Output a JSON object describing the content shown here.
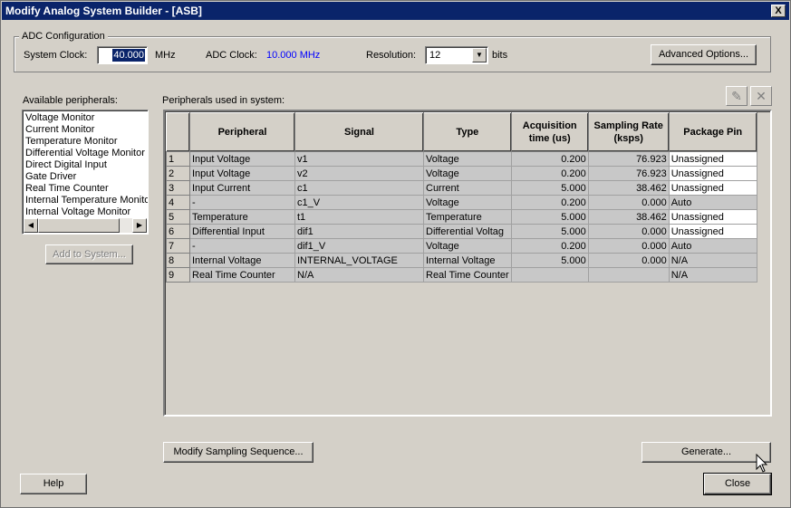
{
  "window": {
    "title": "Modify Analog System Builder - [ASB]",
    "close_glyph": "X"
  },
  "adc": {
    "group_label": "ADC Configuration",
    "system_clock_label": "System Clock:",
    "system_clock_value": "40.000",
    "system_clock_unit": "MHz",
    "adc_clock_label": "ADC Clock:",
    "adc_clock_value": "10.000 MHz",
    "adc_clock_color": "#0000ff",
    "resolution_label": "Resolution:",
    "resolution_value": "12",
    "resolution_unit": "bits",
    "advanced_button": "Advanced Options..."
  },
  "available": {
    "label": "Available peripherals:",
    "items": [
      "Voltage Monitor",
      "Current Monitor",
      "Temperature Monitor",
      "Differential Voltage Monitor",
      "Direct Digital Input",
      "Gate Driver",
      "Real Time Counter",
      "Internal Temperature Monitor",
      "Internal Voltage Monitor"
    ],
    "add_button": "Add to System..."
  },
  "used": {
    "label": "Peripherals used in system:",
    "edit_icon": "pencil-icon",
    "delete_icon": "delete-x-icon",
    "columns": [
      "",
      "Peripheral",
      "Signal",
      "Type",
      "Acquisition time (us)",
      "Sampling Rate (ksps)",
      "Package Pin"
    ],
    "rows": [
      {
        "n": "1",
        "peripheral": "Input Voltage",
        "signal": "v1",
        "type": "Voltage",
        "acq": "0.200",
        "rate": "76.923",
        "pin": "Unassigned",
        "pin_editable": true
      },
      {
        "n": "2",
        "peripheral": "Input Voltage",
        "signal": "v2",
        "type": "Voltage",
        "acq": "0.200",
        "rate": "76.923",
        "pin": "Unassigned",
        "pin_editable": true
      },
      {
        "n": "3",
        "peripheral": "Input Current",
        "signal": "c1",
        "type": "Current",
        "acq": "5.000",
        "rate": "38.462",
        "pin": "Unassigned",
        "pin_editable": true
      },
      {
        "n": "4",
        "peripheral": "-",
        "signal": "c1_V",
        "type": "Voltage",
        "acq": "0.200",
        "rate": "0.000",
        "pin": "Auto",
        "pin_editable": false
      },
      {
        "n": "5",
        "peripheral": "Temperature",
        "signal": "t1",
        "type": "Temperature",
        "acq": "5.000",
        "rate": "38.462",
        "pin": "Unassigned",
        "pin_editable": true
      },
      {
        "n": "6",
        "peripheral": "Differential Input",
        "signal": "dif1",
        "type": "Differential Voltag",
        "acq": "5.000",
        "rate": "0.000",
        "pin": "Unassigned",
        "pin_editable": true
      },
      {
        "n": "7",
        "peripheral": "-",
        "signal": "dif1_V",
        "type": "Voltage",
        "acq": "0.200",
        "rate": "0.000",
        "pin": "Auto",
        "pin_editable": false
      },
      {
        "n": "8",
        "peripheral": "Internal Voltage",
        "signal": "INTERNAL_VOLTAGE",
        "type": "Internal Voltage",
        "acq": "5.000",
        "rate": "0.000",
        "pin": "N/A",
        "pin_editable": false
      },
      {
        "n": "9",
        "peripheral": "Real Time Counter",
        "signal": "N/A",
        "type": "Real Time Counter",
        "acq": "",
        "rate": "",
        "pin": "N/A",
        "pin_editable": false
      }
    ]
  },
  "buttons": {
    "modify_sequence": "Modify Sampling Sequence...",
    "generate": "Generate...",
    "help": "Help",
    "close": "Close"
  }
}
